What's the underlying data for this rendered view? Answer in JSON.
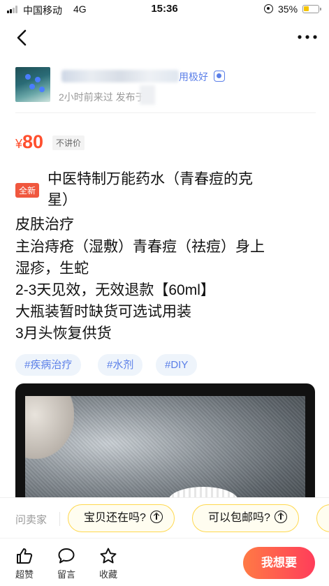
{
  "status_bar": {
    "carrier": "中国移动",
    "network": "4G",
    "time": "15:36",
    "battery_percent": "35%",
    "battery_level": 0.35
  },
  "nav": {
    "back_icon": "chevron-left-icon",
    "more_icon": "more-dots-icon"
  },
  "seller": {
    "name_suffix": "用极好",
    "meta": "2小时前来过 发布于"
  },
  "product": {
    "currency": "¥",
    "price": "80",
    "price_tag": "不讲价",
    "condition_badge": "全新",
    "title_line1": "中医特制万能药水（青春痘的克",
    "title_line2": "星）",
    "lines": [
      "皮肤治疗",
      "主治痔疮（湿敷）青春痘（祛痘）身上",
      "湿疹，生蛇",
      "2-3天见效，无效退款【60ml】",
      "大瓶装暂时缺货可选试用装",
      "3月头恢复供货"
    ],
    "tags": [
      "#疾病治疗",
      "#水剂",
      "#DIY"
    ]
  },
  "ask_bar": {
    "label": "问卖家",
    "questions": [
      "宝贝还在吗?",
      "可以包邮吗?"
    ]
  },
  "bottom_bar": {
    "like_label": "超赞",
    "comment_label": "留言",
    "favorite_label": "收藏",
    "want_label": "我想要"
  },
  "colors": {
    "price": "#ff4f2e",
    "tag_text": "#5b7fe8",
    "quick_question_border": "#ffd84d",
    "want_gradient_start": "#ff7a45",
    "want_gradient_end": "#ff3d5a"
  }
}
